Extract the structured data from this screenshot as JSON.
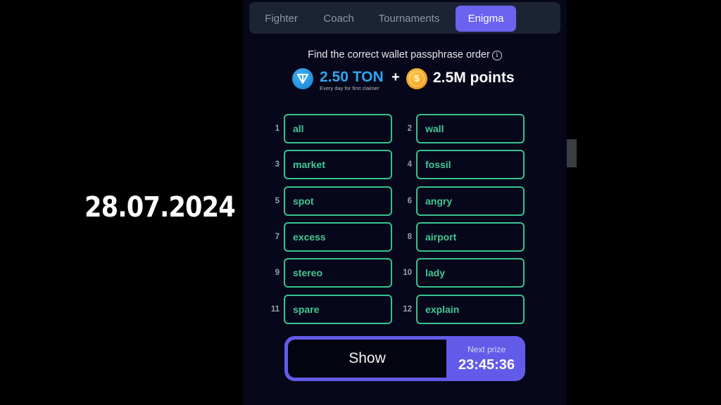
{
  "overlay": {
    "date": "28.07.2024"
  },
  "tabs": [
    {
      "label": "Fighter",
      "active": false
    },
    {
      "label": "Coach",
      "active": false
    },
    {
      "label": "Tournaments",
      "active": false
    },
    {
      "label": "Enigma",
      "active": true
    }
  ],
  "enigma": {
    "title": "Find the correct wallet passphrase order",
    "info_icon": "info-circle-icon",
    "reward": {
      "ton_icon": "ton-logo-icon",
      "ton_amount": "2.50 TON",
      "ton_note": "Every day for first claimer",
      "plus": "+",
      "coin_icon": "dollar-coin-icon",
      "points": "2.5M points"
    },
    "words": [
      {
        "n": "1",
        "word": "all"
      },
      {
        "n": "2",
        "word": "wall"
      },
      {
        "n": "3",
        "word": "market"
      },
      {
        "n": "4",
        "word": "fossil"
      },
      {
        "n": "5",
        "word": "spot"
      },
      {
        "n": "6",
        "word": "angry"
      },
      {
        "n": "7",
        "word": "excess"
      },
      {
        "n": "8",
        "word": "airport"
      },
      {
        "n": "9",
        "word": "stereo"
      },
      {
        "n": "10",
        "word": "lady"
      },
      {
        "n": "11",
        "word": "spare"
      },
      {
        "n": "12",
        "word": "explain"
      }
    ],
    "show_button": "Show",
    "next_prize_label": "Next prize",
    "next_prize_timer": "23:45:36"
  },
  "colors": {
    "accent": "#6b63f0",
    "word_green": "#43c894",
    "ton_blue": "#2fa6ec",
    "background": "#06071a"
  }
}
